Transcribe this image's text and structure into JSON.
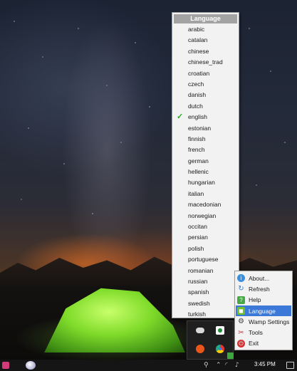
{
  "language_menu": {
    "header": "Language",
    "items": [
      {
        "label": "arabic",
        "checked": false
      },
      {
        "label": "catalan",
        "checked": false
      },
      {
        "label": "chinese",
        "checked": false
      },
      {
        "label": "chinese_trad",
        "checked": false
      },
      {
        "label": "croatian",
        "checked": false
      },
      {
        "label": "czech",
        "checked": false
      },
      {
        "label": "danish",
        "checked": false
      },
      {
        "label": "dutch",
        "checked": false
      },
      {
        "label": "english",
        "checked": true
      },
      {
        "label": "estonian",
        "checked": false
      },
      {
        "label": "finnish",
        "checked": false
      },
      {
        "label": "french",
        "checked": false
      },
      {
        "label": "german",
        "checked": false
      },
      {
        "label": "hellenic",
        "checked": false
      },
      {
        "label": "hungarian",
        "checked": false
      },
      {
        "label": "italian",
        "checked": false
      },
      {
        "label": "macedonian",
        "checked": false
      },
      {
        "label": "norwegian",
        "checked": false
      },
      {
        "label": "occitan",
        "checked": false
      },
      {
        "label": "persian",
        "checked": false
      },
      {
        "label": "polish",
        "checked": false
      },
      {
        "label": "portuguese",
        "checked": false
      },
      {
        "label": "romanian",
        "checked": false
      },
      {
        "label": "russian",
        "checked": false
      },
      {
        "label": "spanish",
        "checked": false
      },
      {
        "label": "swedish",
        "checked": false
      },
      {
        "label": "turkish",
        "checked": false
      }
    ],
    "check_glyph": "✓"
  },
  "wamp_menu": {
    "items": [
      {
        "label": "About...",
        "icon": "info-icon",
        "active": false
      },
      {
        "label": "Refresh",
        "icon": "refresh-icon",
        "active": false
      },
      {
        "label": "Help",
        "icon": "help-icon",
        "active": false
      },
      {
        "label": "Language",
        "icon": "language-icon",
        "active": true
      },
      {
        "label": "Wamp Settings",
        "icon": "settings-icon",
        "active": false
      },
      {
        "label": "Tools",
        "icon": "tools-icon",
        "active": false
      },
      {
        "label": "Exit",
        "icon": "exit-icon",
        "active": false
      }
    ]
  },
  "taskbar": {
    "time": "3:45 PM"
  },
  "colors": {
    "menu_bg": "#f2f2f2",
    "menu_header": "#a3a3a3",
    "highlight": "#3b78d8",
    "check": "#2ea82e",
    "taskbar": "#151515"
  }
}
